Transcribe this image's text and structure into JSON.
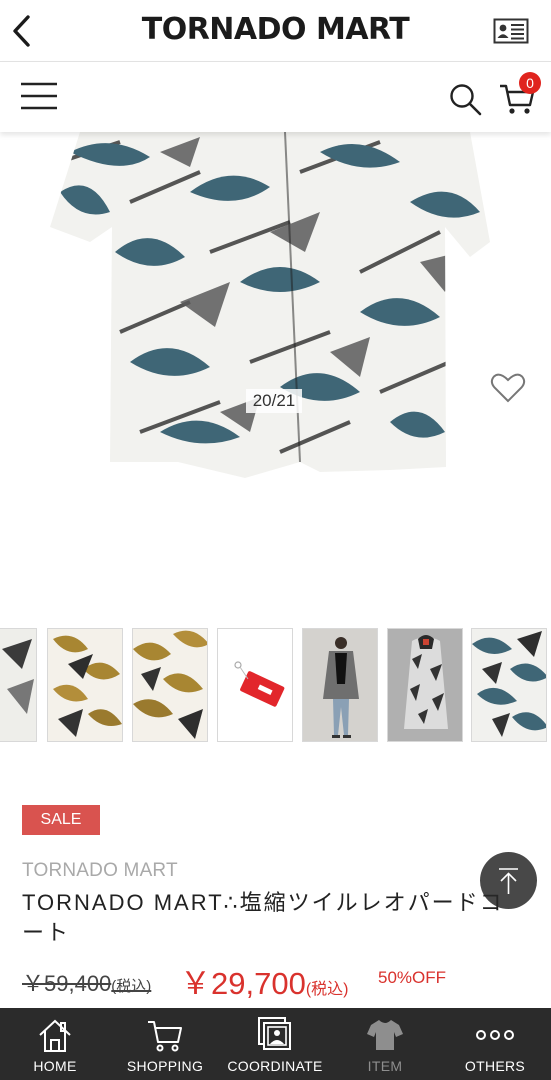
{
  "header": {
    "brand": "TORNADO MART"
  },
  "cart": {
    "count": "0"
  },
  "gallery": {
    "counter": "20/21"
  },
  "product": {
    "sale_label": "SALE",
    "brand": "TORNADO MART",
    "title": "TORNADO MART∴塩縮ツイルレオパードコート",
    "original_price": "￥59,400",
    "original_tax": "(税込)",
    "sale_price": "￥29,700",
    "sale_tax": "(税込)",
    "discount": "50%OFF"
  },
  "tabs": [
    {
      "label": "HOME",
      "icon": "home-icon"
    },
    {
      "label": "SHOPPING",
      "icon": "cart-icon"
    },
    {
      "label": "COORDINATE",
      "icon": "photos-icon"
    },
    {
      "label": "ITEM",
      "icon": "tshirt-icon"
    },
    {
      "label": "OTHERS",
      "icon": "more-dots-icon"
    }
  ],
  "colors": {
    "accent_red": "#d9322d",
    "sale_badge": "#d9534f",
    "tabbar_bg": "#2b2b2b"
  }
}
